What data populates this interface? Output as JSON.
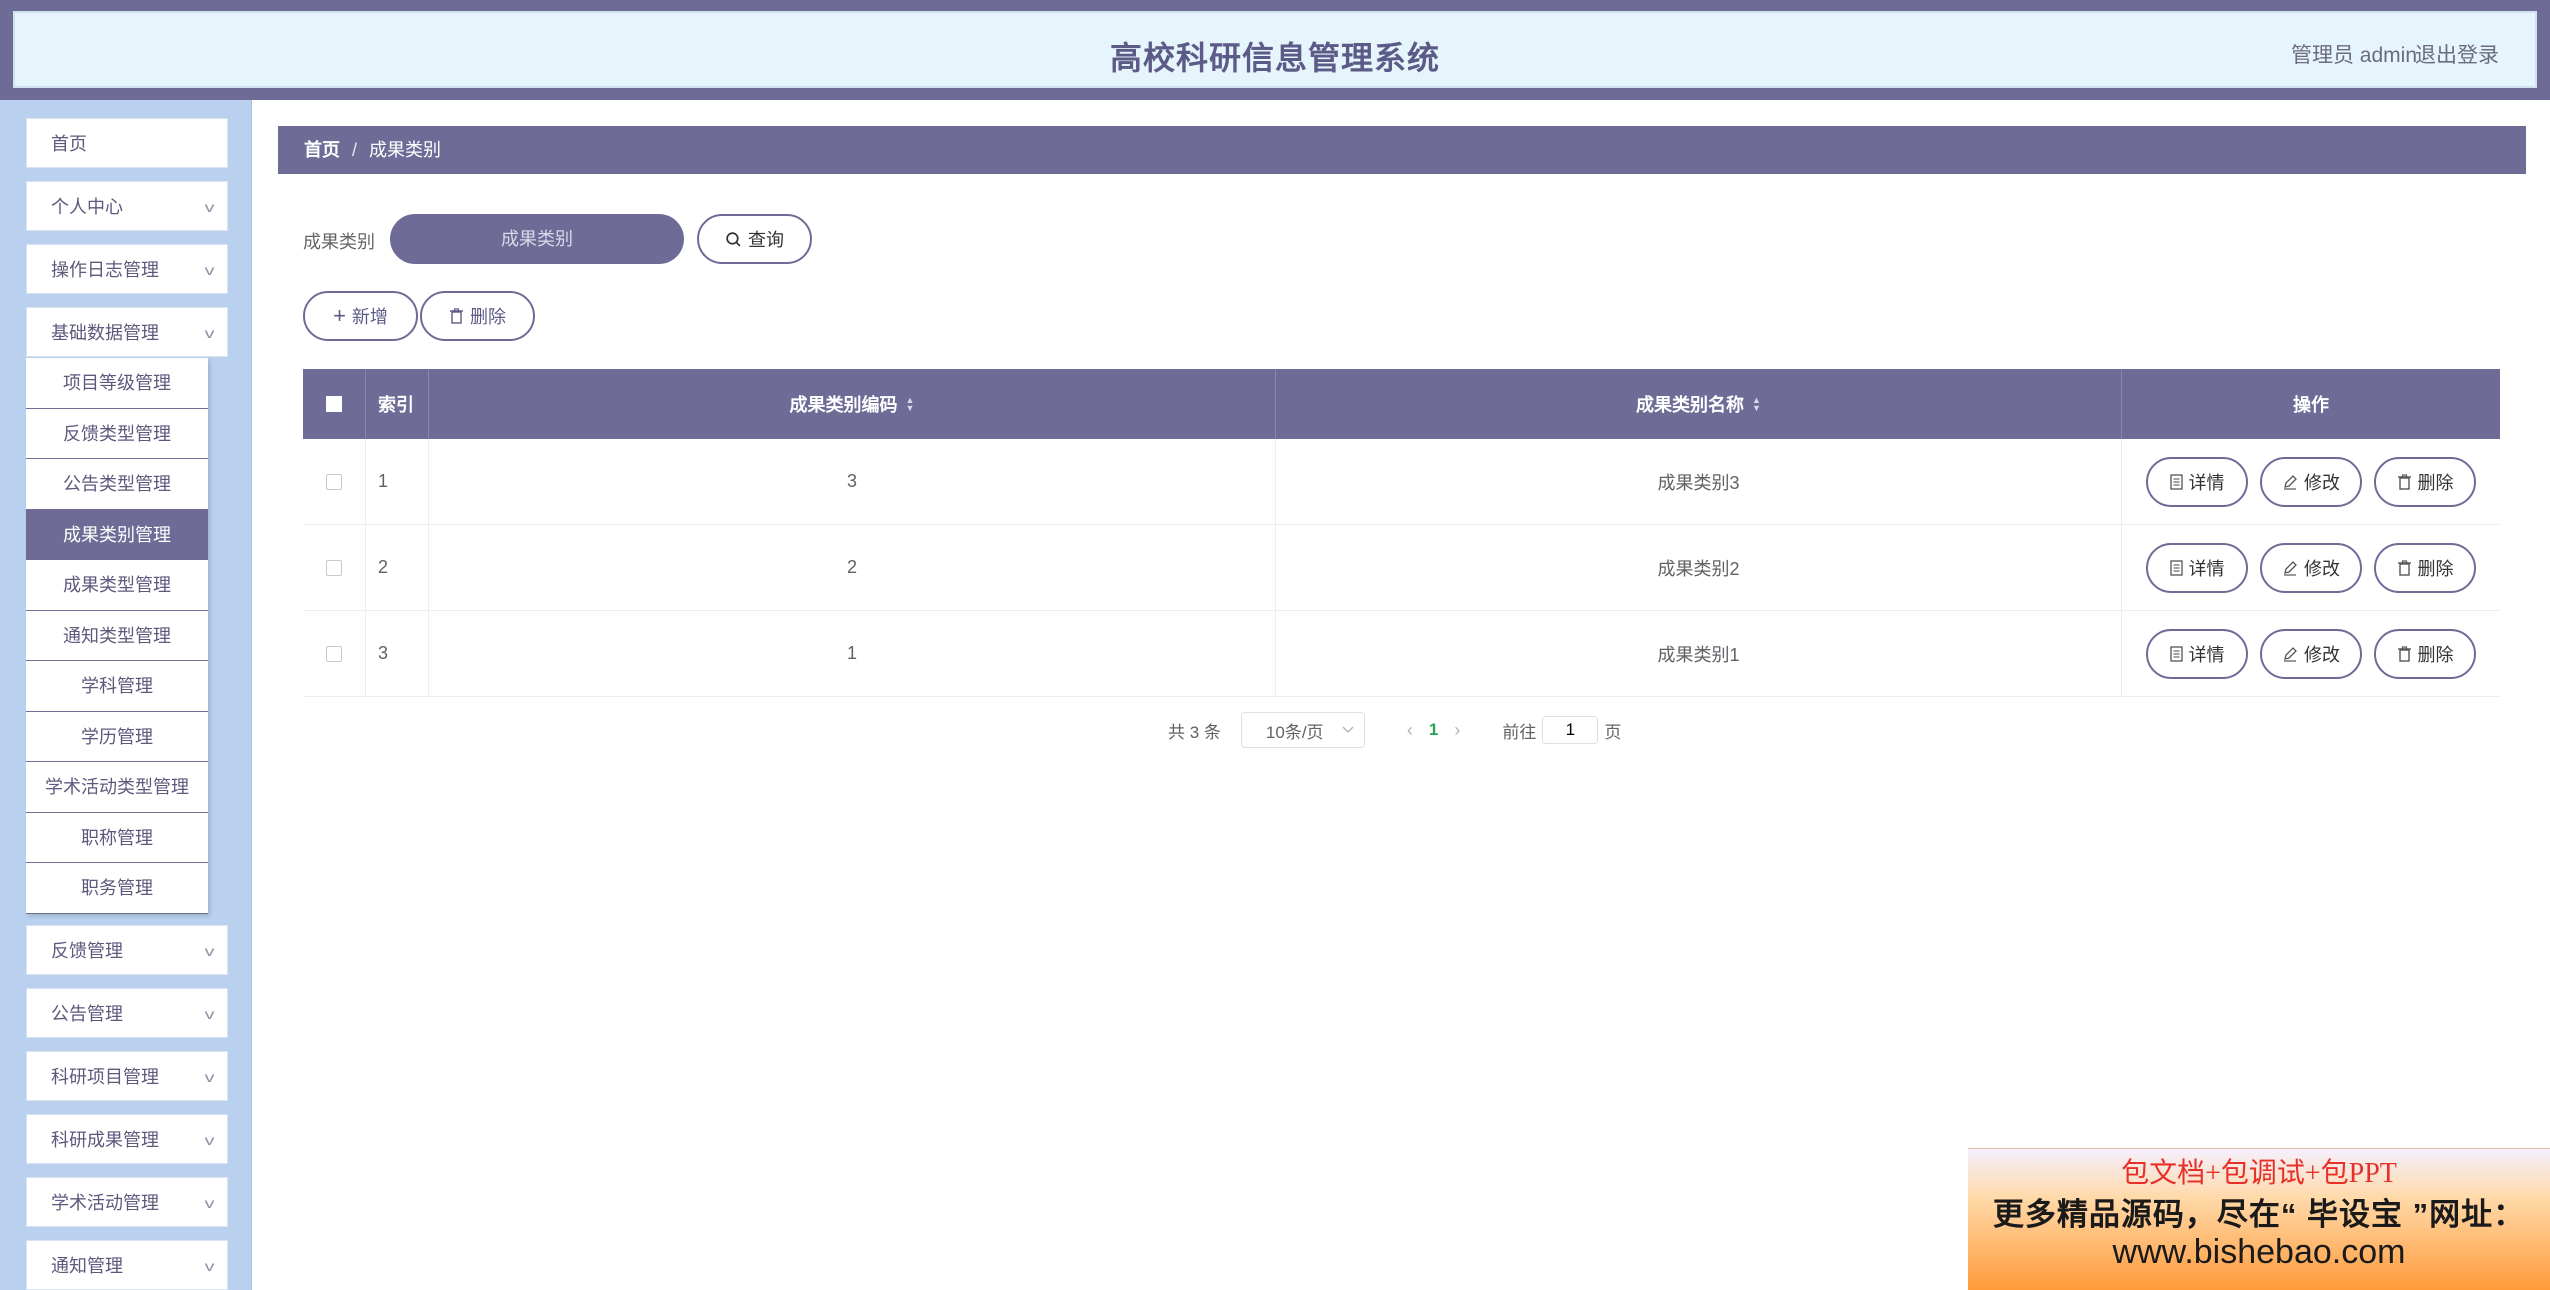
{
  "header": {
    "title": "高校科研信息管理系统",
    "admin_label": "管理员 admin",
    "logout_label": "退出登录"
  },
  "sidebar": {
    "menu_top": [
      {
        "label": "首页",
        "has_chevron": false
      },
      {
        "label": "个人中心",
        "has_chevron": true
      },
      {
        "label": "操作日志管理",
        "has_chevron": true
      },
      {
        "label": "基础数据管理",
        "has_chevron": true
      }
    ],
    "submenu": [
      {
        "label": "项目等级管理"
      },
      {
        "label": "反馈类型管理"
      },
      {
        "label": "公告类型管理"
      },
      {
        "label": "成果类别管理",
        "active": true
      },
      {
        "label": "成果类型管理"
      },
      {
        "label": "通知类型管理"
      },
      {
        "label": "学科管理"
      },
      {
        "label": "学历管理"
      },
      {
        "label": "学术活动类型管理"
      },
      {
        "label": "职称管理"
      },
      {
        "label": "职务管理"
      }
    ],
    "menu_bottom": [
      {
        "label": "反馈管理"
      },
      {
        "label": "公告管理"
      },
      {
        "label": "科研项目管理"
      },
      {
        "label": "科研成果管理"
      },
      {
        "label": "学术活动管理"
      },
      {
        "label": "通知管理"
      }
    ],
    "chevron_glyph": "v"
  },
  "breadcrumb": {
    "home": "首页",
    "separator": "/",
    "current": "成果类别"
  },
  "search": {
    "label": "成果类别",
    "placeholder": "成果类别",
    "query_label": "查询"
  },
  "toolbar": {
    "add_label": "新增",
    "delete_label": "删除"
  },
  "table": {
    "headers": {
      "index": "索引",
      "code": "成果类别编码",
      "name": "成果类别名称",
      "ops": "操作"
    },
    "rows": [
      {
        "index": "1",
        "code": "3",
        "name": "成果类别3"
      },
      {
        "index": "2",
        "code": "2",
        "name": "成果类别2"
      },
      {
        "index": "3",
        "code": "1",
        "name": "成果类别1"
      }
    ],
    "op_labels": {
      "detail": "详情",
      "edit": "修改",
      "delete": "删除"
    }
  },
  "pagination": {
    "total": "共 3 条",
    "page_size": "10条/页",
    "current_page": "1",
    "goto_prefix": "前往",
    "goto_value": "1",
    "goto_suffix": "页"
  },
  "ad": {
    "line1": "包文档+包调试+包PPT",
    "line2": "更多精品源码，尽在“ 毕设宝 ”网址：",
    "line3": "www.bishebao.com"
  },
  "colors": {
    "theme": "#6e6c96",
    "sidebar_bg": "#b9d1ee",
    "header_bg": "#e6f4fc",
    "page_active": "#2aa35a"
  }
}
